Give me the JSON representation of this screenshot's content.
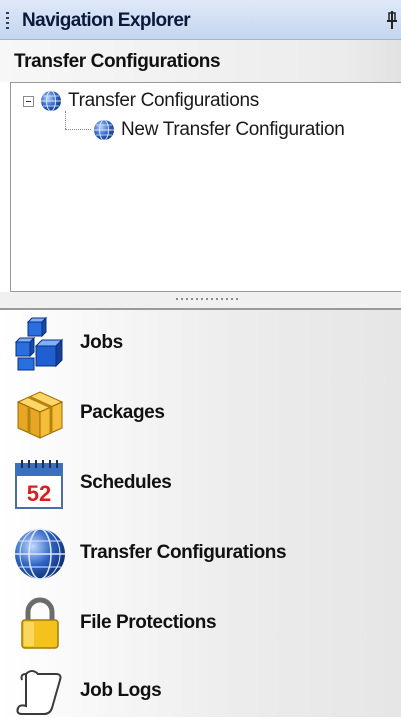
{
  "panel": {
    "title": "Navigation Explorer",
    "pin_glyph": "ᵖ"
  },
  "section": {
    "title": "Transfer Configurations"
  },
  "tree": {
    "root": {
      "label": "Transfer Configurations",
      "icon": "globe-icon",
      "expanded": true
    },
    "child": {
      "label": "New Transfer Configuration",
      "icon": "globe-icon"
    }
  },
  "nav": {
    "items": [
      {
        "label": "Jobs",
        "icon": "blue-cubes-icon"
      },
      {
        "label": "Packages",
        "icon": "package-box-icon"
      },
      {
        "label": "Schedules",
        "icon": "calendar-icon"
      },
      {
        "label": "Transfer Configurations",
        "icon": "globe-icon"
      },
      {
        "label": "File Protections",
        "icon": "padlock-icon"
      },
      {
        "label": "Job Logs",
        "icon": "scroll-icon"
      }
    ]
  },
  "calendar": {
    "day": "52"
  }
}
